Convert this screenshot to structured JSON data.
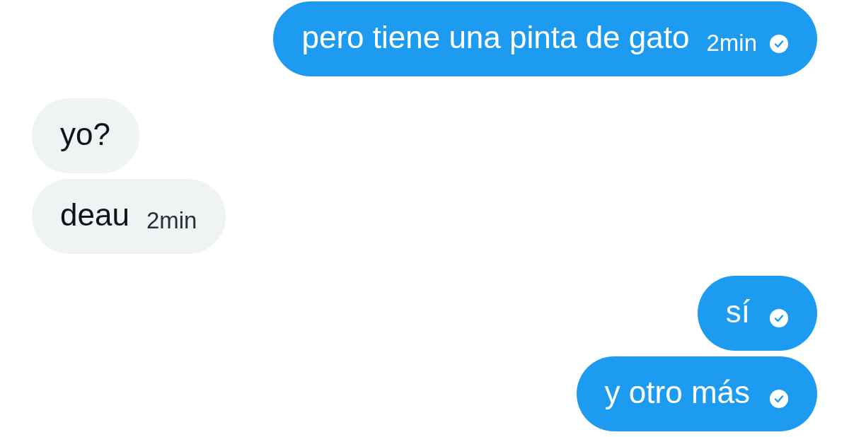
{
  "conversation": {
    "groups": [
      {
        "kind": "sent",
        "messages": [
          {
            "text": "pero tiene una pinta de gato",
            "time": "2min",
            "read": true
          }
        ]
      },
      {
        "kind": "received",
        "messages": [
          {
            "text": "yo?"
          },
          {
            "text": "deau",
            "time": "2min"
          }
        ]
      },
      {
        "kind": "sent",
        "messages": [
          {
            "text": "sí",
            "read": true
          },
          {
            "text": "y otro más",
            "read": true
          }
        ]
      }
    ]
  }
}
